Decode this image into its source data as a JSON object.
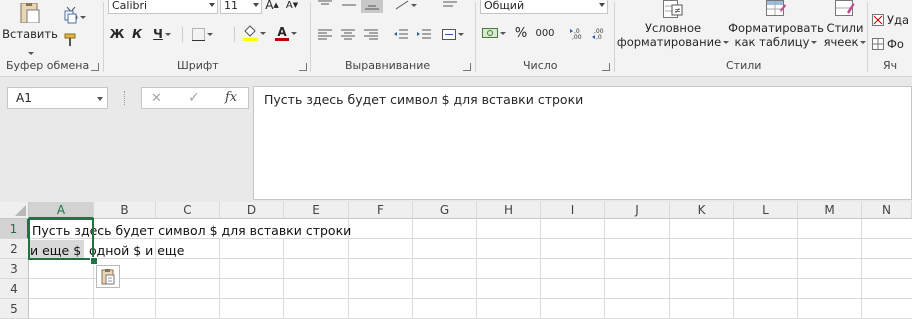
{
  "clipboard": {
    "paste_label": "Вставить",
    "group_label": "Буфер обмена"
  },
  "font": {
    "name": "Calibri",
    "size": "11",
    "bold": "Ж",
    "italic": "К",
    "underline": "Ч",
    "color_letter": "А",
    "group_label": "Шрифт"
  },
  "alignment": {
    "group_label": "Выравнивание"
  },
  "number": {
    "format": "Общий",
    "percent": "%",
    "thousands": "000",
    "group_label": "Число"
  },
  "styles": {
    "conditional_line1": "Условное",
    "conditional_line2": "форматирование",
    "table_line1": "Форматировать",
    "table_line2": "как таблицу",
    "cell_styles_line1": "Стили",
    "cell_styles_line2": "ячеек",
    "group_label": "Стили"
  },
  "cells": {
    "delete_label": "Уда",
    "format_label": "Фо",
    "group_label": "Яч"
  },
  "formula_bar": {
    "name_box": "A1",
    "cancel": "✕",
    "enter": "✓",
    "fx": "fx",
    "content": "Пусть здесь будет символ $ для вставки строки"
  },
  "sheet": {
    "columns": [
      "A",
      "B",
      "C",
      "D",
      "E",
      "F",
      "G",
      "H",
      "I",
      "J",
      "K",
      "L",
      "M",
      "N"
    ],
    "rows": [
      "1",
      "2",
      "3",
      "4",
      "5"
    ],
    "a1_text": "Пусть здесь будет символ $ для вставки строки",
    "a2_text_part1": " и еще $ ",
    "a2_text_part2": "одной $ и еще"
  },
  "colors": {
    "selection_green": "#217346",
    "font_red": "#c00000",
    "highlight_yellow": "#ffff00"
  }
}
